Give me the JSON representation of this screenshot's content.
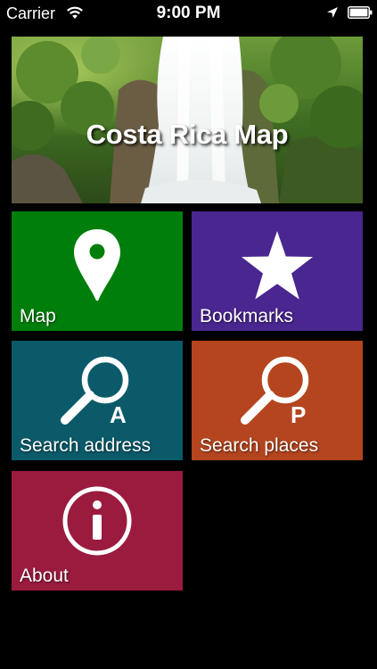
{
  "status_bar": {
    "carrier": "Carrier",
    "time": "9:00 PM",
    "icons": [
      "wifi-icon",
      "location-arrow-icon",
      "battery-icon"
    ]
  },
  "banner": {
    "title": "Costa Rica Map",
    "image": "waterfall-photo"
  },
  "tiles": [
    {
      "label": "Map",
      "icon": "map-pin-icon",
      "color": "#007e0b"
    },
    {
      "label": "Bookmarks",
      "icon": "star-icon",
      "color": "#4a2690"
    },
    {
      "label": "Search address",
      "icon": "search-address-icon",
      "badge": "A",
      "color": "#0b5a6a"
    },
    {
      "label": "Search places",
      "icon": "search-places-icon",
      "badge": "P",
      "color": "#b4451e"
    },
    {
      "label": "About",
      "icon": "info-icon",
      "color": "#9b1b3f"
    }
  ],
  "colors": {
    "background": "#000000"
  }
}
